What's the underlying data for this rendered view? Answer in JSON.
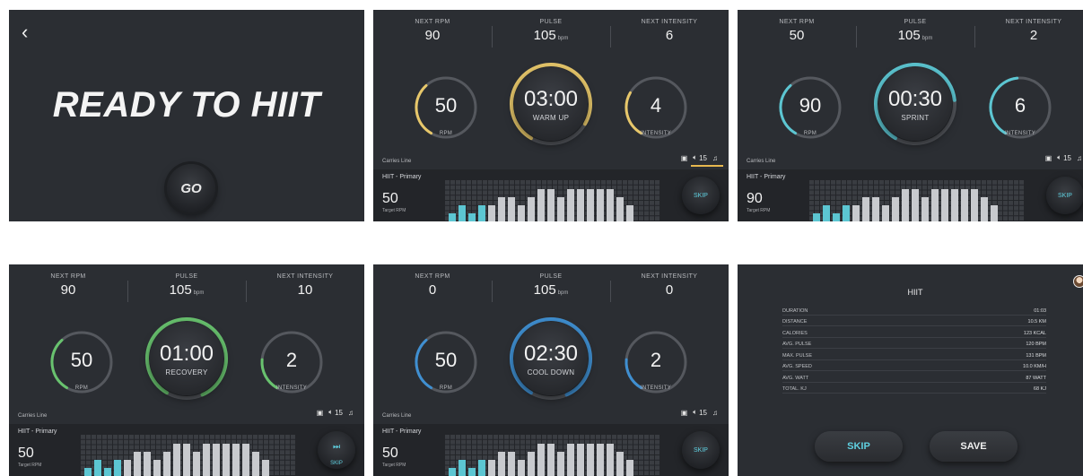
{
  "colors": {
    "warmup": "#e7c76a",
    "sprint": "#5cc6d2",
    "recovery": "#68c26e",
    "cooldown": "#3f8fd1",
    "track": "#55585e",
    "bar_highlight": "#5cc6d2",
    "bar_normal": "#c8cace",
    "grid_cell": "#3a3d42"
  },
  "ready": {
    "back_icon": "chevron-left-icon",
    "title": "READY TO HIIT",
    "go_label": "GO"
  },
  "labels": {
    "next_rpm": "NEXT RPM",
    "pulse": "PULSE",
    "next_intensity": "NEXT INTENSITY",
    "bpm": "bpm",
    "rpm": "RPM",
    "intensity": "INTENSITY",
    "carries_line": "Carries Line",
    "volume": "15",
    "program": "HIIT - Primary",
    "target_rpm": "Target RPM",
    "skip": "SKIP"
  },
  "workouts": [
    {
      "phase": "warmup",
      "next_rpm": "90",
      "pulse": "105",
      "next_intensity": "6",
      "rpm": "50",
      "time": "03:00",
      "phase_label": "WARM UP",
      "intensity": "4",
      "target_rpm": "50",
      "rpm_fraction": 0.3,
      "intensity_fraction": 0.25,
      "time_fraction": 0.75,
      "bars": [
        1,
        2,
        1,
        2,
        2,
        3,
        3,
        2,
        3,
        4,
        4,
        3,
        4,
        4,
        4,
        4,
        4,
        3,
        2
      ]
    },
    {
      "phase": "sprint",
      "next_rpm": "50",
      "pulse": "105",
      "next_intensity": "2",
      "rpm": "90",
      "time": "00:30",
      "phase_label": "SPRINT",
      "intensity": "6",
      "target_rpm": "90",
      "rpm_fraction": 0.3,
      "intensity_fraction": 0.4,
      "time_fraction": 0.65,
      "bars": [
        1,
        2,
        1,
        2,
        2,
        3,
        3,
        2,
        3,
        4,
        4,
        3,
        4,
        4,
        4,
        4,
        4,
        3,
        2
      ]
    },
    {
      "phase": "recovery",
      "next_rpm": "90",
      "pulse": "105",
      "next_intensity": "10",
      "rpm": "50",
      "time": "01:00",
      "phase_label": "RECOVERY",
      "intensity": "2",
      "target_rpm": "50",
      "rpm_fraction": 0.3,
      "intensity_fraction": 0.18,
      "time_fraction": 0.85,
      "bars": [
        1,
        2,
        1,
        2,
        2,
        3,
        3,
        2,
        3,
        4,
        4,
        3,
        4,
        4,
        4,
        4,
        4,
        3,
        2
      ]
    },
    {
      "phase": "cooldown",
      "next_rpm": "0",
      "pulse": "105",
      "next_intensity": "0",
      "rpm": "50",
      "time": "02:30",
      "phase_label": "COOL DOWN",
      "intensity": "2",
      "target_rpm": "50",
      "rpm_fraction": 0.3,
      "intensity_fraction": 0.18,
      "time_fraction": 0.85,
      "bars": [
        1,
        2,
        1,
        2,
        2,
        3,
        3,
        2,
        3,
        4,
        4,
        3,
        4,
        4,
        4,
        4,
        4,
        3,
        2
      ]
    }
  ],
  "summary": {
    "title": "HIIT",
    "rows": [
      {
        "label": "DURATION",
        "value": "01:03"
      },
      {
        "label": "DISTANCE",
        "value": "10.5 KM"
      },
      {
        "label": "CALORIES",
        "value": "123 KCAL"
      },
      {
        "label": "AVG. PULSE",
        "value": "120 BPM"
      },
      {
        "label": "MAX. PULSE",
        "value": "131 BPM"
      },
      {
        "label": "AVG. SPEED",
        "value": "10.0 KM/H"
      },
      {
        "label": "AVG. WATT",
        "value": "87 WATT"
      },
      {
        "label": "TOTAL. KJ",
        "value": "68 KJ"
      }
    ],
    "skip_label": "SKIP",
    "save_label": "SAVE"
  }
}
